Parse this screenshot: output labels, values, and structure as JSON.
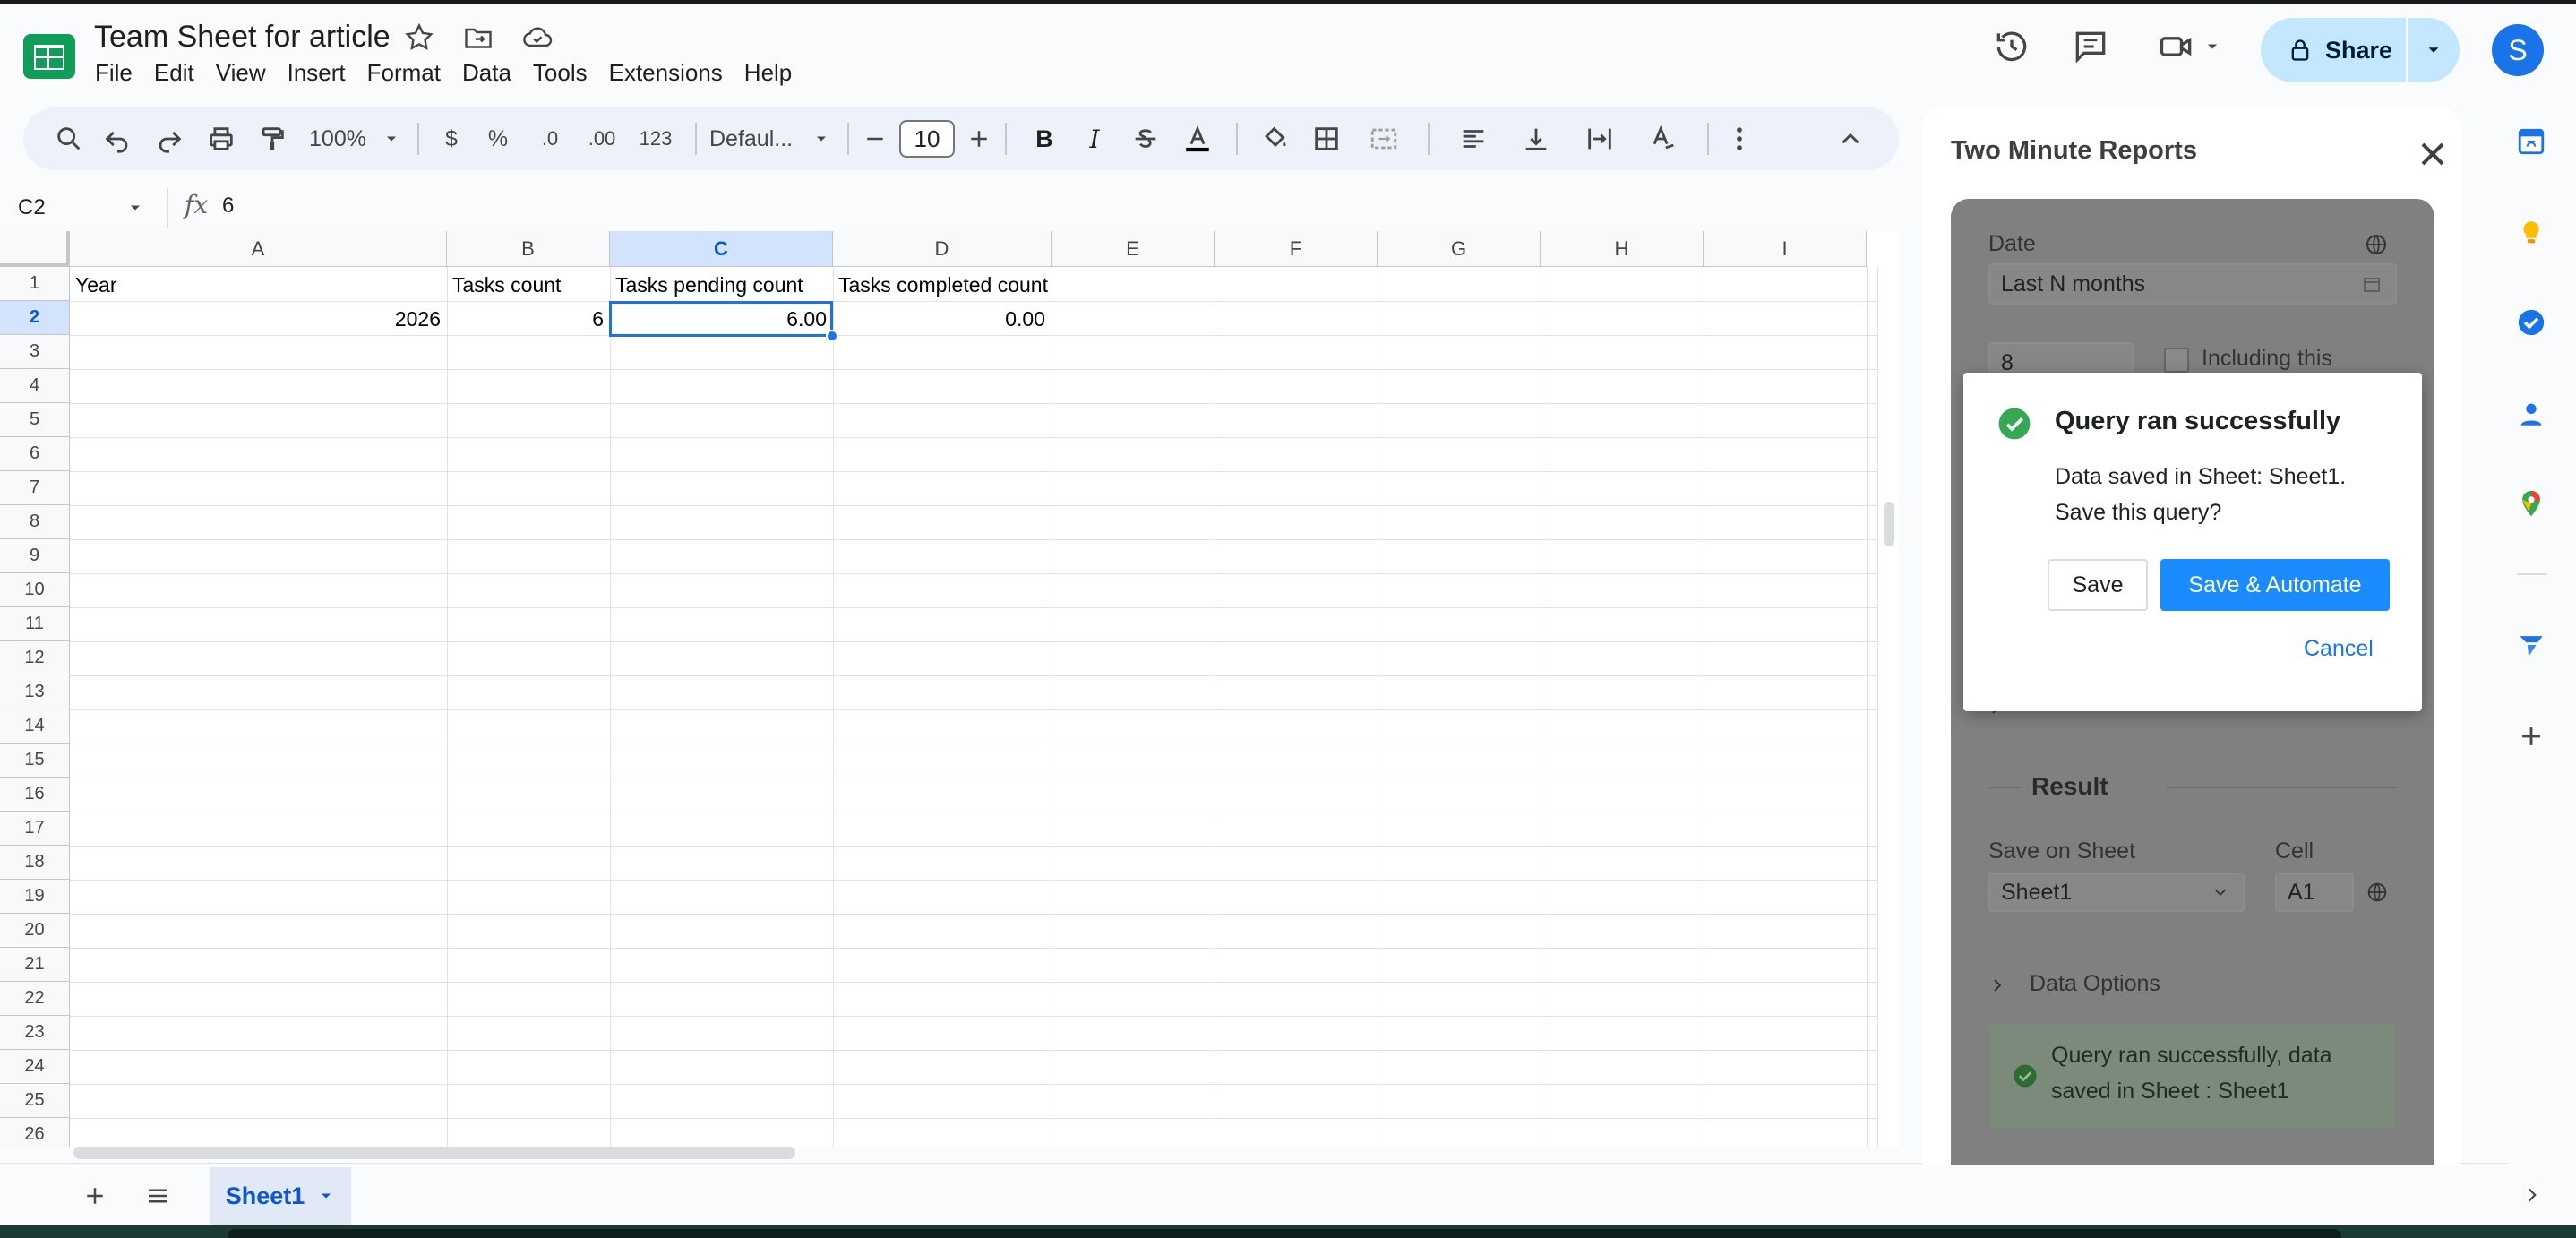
{
  "app": {
    "title": "Team Sheet for article",
    "menus": [
      "File",
      "Edit",
      "View",
      "Insert",
      "Format",
      "Data",
      "Tools",
      "Extensions",
      "Help"
    ],
    "share_label": "Share",
    "avatar_initial": "S",
    "accent": "#1a73e8",
    "share_bg": "#c2e7ff"
  },
  "toolbar": {
    "zoom": "100%",
    "currency": "$",
    "percent": "%",
    "dec_decrease": ".0",
    "dec_increase": ".00",
    "number_format": "123",
    "font": "Defaul...",
    "font_size": "10",
    "bold": "B",
    "italic": "I"
  },
  "formula_bar": {
    "cell_ref": "C2",
    "fx": "fx",
    "value": "6"
  },
  "grid": {
    "columns": [
      "A",
      "B",
      "C",
      "D",
      "E",
      "F",
      "G",
      "H",
      "I"
    ],
    "selected_column": "C",
    "rows": [
      "1",
      "2",
      "3",
      "4",
      "5",
      "6",
      "7",
      "8",
      "9",
      "10",
      "11",
      "12",
      "13",
      "14",
      "15",
      "16",
      "17",
      "18",
      "19",
      "20",
      "21",
      "22",
      "23",
      "24",
      "25",
      "26"
    ],
    "selected_row": "2",
    "header_row": [
      "Year",
      "Tasks count",
      "Tasks pending count",
      "Tasks completed count"
    ],
    "data_row": [
      "2026",
      "6",
      "6.00",
      "0.00"
    ]
  },
  "tabs": {
    "sheet_name": "Sheet1"
  },
  "panel": {
    "title": "Two Minute Reports",
    "date_label": "Date",
    "date_value": "Last N months",
    "n_value": "8",
    "including_label": "Including this",
    "result_heading": "Result",
    "save_on_sheet_label": "Save on Sheet",
    "save_on_sheet_value": "Sheet1",
    "cell_label": "Cell",
    "cell_value": "A1",
    "data_options_label": "Data Options",
    "success_message": "Query ran successfully, data saved in Sheet : Sheet1"
  },
  "dialog": {
    "title": "Query ran successfully",
    "message": "Data saved in Sheet: Sheet1. Save this query?",
    "save_label": "Save",
    "automate_label": "Save & Automate",
    "cancel_label": "Cancel"
  }
}
